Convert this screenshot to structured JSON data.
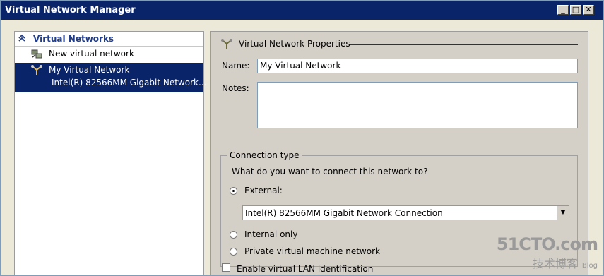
{
  "window": {
    "title": "Virtual Network Manager"
  },
  "titlebar": {
    "minimize_label": "_",
    "maximize_label": "□",
    "close_label": "✕"
  },
  "tree": {
    "header": "Virtual Networks",
    "items": [
      {
        "label": "New virtual network",
        "icon": "new-network-icon"
      },
      {
        "label": "My Virtual Network",
        "sublabel": "Intel(R) 82566MM Gigabit Network...",
        "icon": "network-icon",
        "selected": true
      }
    ]
  },
  "props": {
    "section_title": "Virtual Network Properties",
    "name_label": "Name:",
    "name_value": "My Virtual Network",
    "notes_label": "Notes:",
    "notes_value": "",
    "connection": {
      "legend": "Connection type",
      "question": "What do you want to connect this network to?",
      "external_label": "External:",
      "adapter_value": "Intel(R) 82566MM Gigabit Network Connection",
      "internal_label": "Internal only",
      "private_label": "Private virtual machine network",
      "selected": "external"
    },
    "vlan_label": "Enable virtual LAN identification"
  },
  "watermark": {
    "site": "51CTO.com",
    "cn": "技术博客",
    "blog": "Blog"
  },
  "colors": {
    "selection": "#0a246a",
    "titlebar": "#0a246a",
    "panel": "#d4d0c8"
  }
}
